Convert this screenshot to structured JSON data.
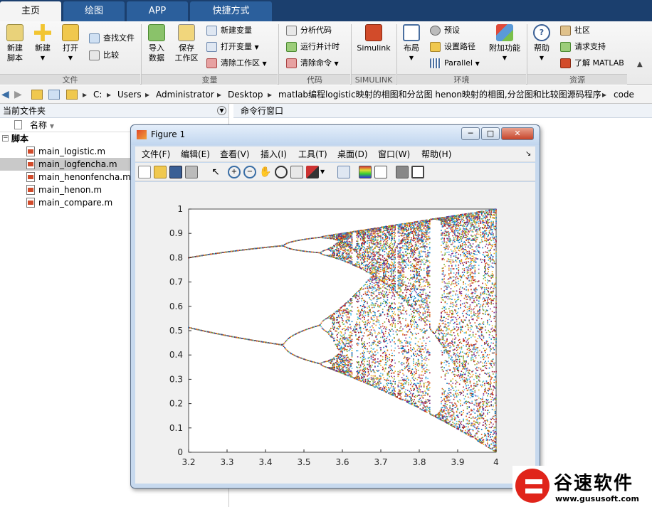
{
  "tabs": [
    {
      "label": "主页"
    },
    {
      "label": "绘图"
    },
    {
      "label": "APP"
    },
    {
      "label": "快捷方式"
    }
  ],
  "ribbon": {
    "new_script": "新建\n脚本",
    "new": "新建",
    "open": "打开",
    "find_files": "查找文件",
    "compare": "比较",
    "import_data": "导入\n数据",
    "save_workspace": "保存\n工作区",
    "new_variable": "新建变量",
    "open_variable": "打开变量",
    "clear_workspace": "清除工作区",
    "analyze_code": "分析代码",
    "run_and_time": "运行并计时",
    "clear_commands": "清除命令",
    "simulink": "Simulink",
    "layout": "布局",
    "preferences": "预设",
    "set_path": "设置路径",
    "parallel": "Parallel",
    "addons": "附加功能",
    "help": "帮助",
    "community": "社区",
    "request_support": "请求支持",
    "learn_matlab": "了解 MATLAB",
    "groups": {
      "file": "文件",
      "variable": "变量",
      "code": "代码",
      "simulink": "SIMULINK",
      "environment": "环境",
      "resources": "资源"
    }
  },
  "path": [
    "C:",
    "Users",
    "Administrator",
    "Desktop",
    "matlab编程logistic映射的相图和分岔图 henon映射的相图,分岔图和比较图源码程序",
    "code"
  ],
  "file_browser": {
    "title": "当前文件夹",
    "column": "名称",
    "group": "脚本",
    "files": [
      "main_logistic.m",
      "main_logfencha.m",
      "main_henonfencha.m",
      "main_henon.m",
      "main_compare.m"
    ]
  },
  "command_window": {
    "title": "命令行窗口"
  },
  "figure": {
    "title": "Figure 1",
    "menu": [
      "文件(F)",
      "编辑(E)",
      "查看(V)",
      "插入(I)",
      "工具(T)",
      "桌面(D)",
      "窗口(W)",
      "帮助(H)"
    ]
  },
  "watermark": {
    "brand": "谷速软件",
    "url": "www.gususoft.com"
  },
  "chart_data": {
    "type": "scatter",
    "title": "",
    "xlabel": "",
    "ylabel": "",
    "xlim": [
      3.2,
      4
    ],
    "ylim": [
      0,
      1
    ],
    "xticks": [
      3.2,
      3.3,
      3.4,
      3.5,
      3.6,
      3.7,
      3.8,
      3.9,
      4
    ],
    "yticks": [
      0,
      0.1,
      0.2,
      0.3,
      0.4,
      0.5,
      0.6,
      0.7,
      0.8,
      0.9,
      1
    ],
    "series": [
      {
        "values": []
      }
    ],
    "grid": false
  }
}
